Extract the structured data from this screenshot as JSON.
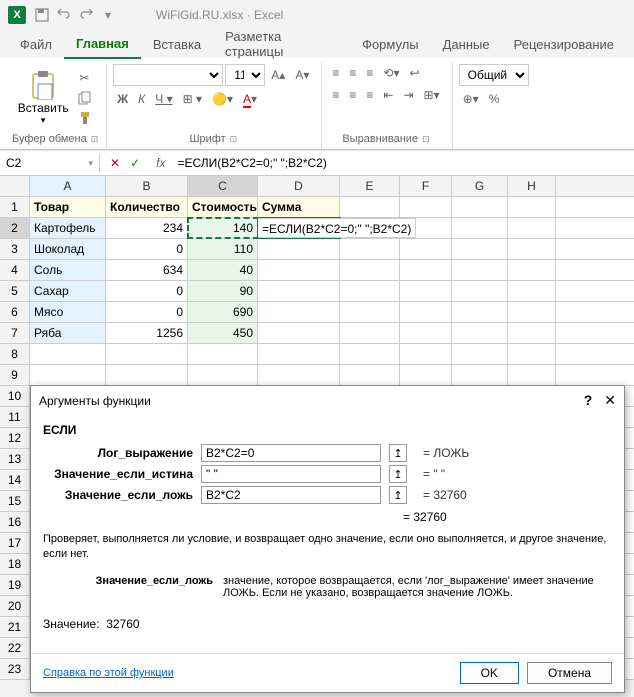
{
  "titlebar": {
    "filename": "WiFiGid.RU.xlsx",
    "app": "Excel"
  },
  "tabs": {
    "file": "Файл",
    "home": "Главная",
    "insert": "Вставка",
    "layout": "Разметка страницы",
    "formulas": "Формулы",
    "data": "Данные",
    "review": "Рецензирование"
  },
  "ribbon": {
    "paste": "Вставить",
    "clipboard": "Буфер обмена",
    "font": "Шрифт",
    "font_size": "11",
    "alignment": "Выравнивание",
    "number_format": "Общий"
  },
  "namebox": "C2",
  "formula": "=ЕСЛИ(B2*C2=0;\" \";B2*C2)",
  "columns": [
    "A",
    "B",
    "C",
    "D",
    "E",
    "F",
    "G",
    "H"
  ],
  "headers": [
    "Товар",
    "Количество",
    "Стоимость",
    "Сумма"
  ],
  "rows": [
    {
      "a": "Картофель",
      "b": "234",
      "c": "140",
      "d": "=ЕСЛИ(B2*C2=0;\" \";B2*C2)"
    },
    {
      "a": "Шоколад",
      "b": "0",
      "c": "110",
      "d": ""
    },
    {
      "a": "Соль",
      "b": "634",
      "c": "40",
      "d": ""
    },
    {
      "a": "Сахар",
      "b": "0",
      "c": "90",
      "d": ""
    },
    {
      "a": "Мясо",
      "b": "0",
      "c": "690",
      "d": ""
    },
    {
      "a": "Ряба",
      "b": "1256",
      "c": "450",
      "d": ""
    }
  ],
  "dialog": {
    "title": "Аргументы функции",
    "func": "ЕСЛИ",
    "args": [
      {
        "label": "Лог_выражение",
        "value": "B2*C2=0",
        "result": "= ЛОЖЬ"
      },
      {
        "label": "Значение_если_истина",
        "value": "\" \"",
        "result": "= \" \""
      },
      {
        "label": "Значение_если_ложь",
        "value": "B2*C2",
        "result": "= 32760"
      }
    ],
    "result_eq": "= 32760",
    "desc": "Проверяет, выполняется ли условие, и возвращает одно значение, если оно выполняется, и другое значение, если нет.",
    "arg_desc_label": "Значение_если_ложь",
    "arg_desc_text": "значение, которое возвращается, если 'лог_выражение' имеет значение ЛОЖЬ. Если не указано, возвращается значение ЛОЖЬ.",
    "value_label": "Значение:",
    "value": "32760",
    "help": "Справка по этой функции",
    "ok": "OK",
    "cancel": "Отмена"
  }
}
